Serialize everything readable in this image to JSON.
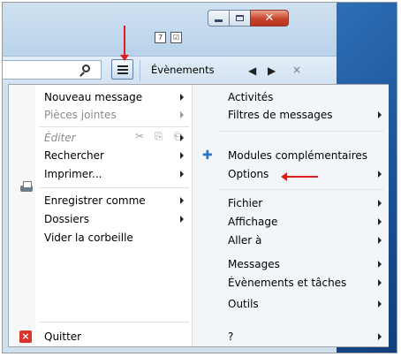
{
  "window": {
    "minimize_icon": "minimize-icon",
    "maximize_icon": "maximize-icon",
    "close_glyph": "✕",
    "calendar_glyph": "7",
    "tasks_glyph": "☑"
  },
  "toolbar": {
    "menu_button_icon": "hamburger-menu-icon",
    "events_tab_label": "Évènements",
    "prev_glyph": "◀",
    "next_glyph": "▶",
    "close_glyph": "×"
  },
  "menu": {
    "left": [
      {
        "label": "Nouveau message",
        "submenu": true,
        "disabled": false
      },
      {
        "label": "Pièces jointes",
        "submenu": true,
        "disabled": true
      },
      {
        "label": "Éditer",
        "submenu": true,
        "disabled": true
      },
      {
        "label": "Rechercher",
        "submenu": true,
        "disabled": false
      },
      {
        "label": "Imprimer...",
        "submenu": true,
        "disabled": false,
        "icon": "printer-icon"
      },
      {
        "label": "Enregistrer comme",
        "submenu": true,
        "disabled": false
      },
      {
        "label": "Dossiers",
        "submenu": true,
        "disabled": false
      },
      {
        "label": "Vider la corbeille",
        "submenu": false,
        "disabled": false
      },
      {
        "label": "Quitter",
        "submenu": false,
        "disabled": false,
        "icon": "quit-icon"
      }
    ],
    "edit_tools": "✂ ⎘ ⎗",
    "right": [
      {
        "label": "Activités",
        "submenu": false
      },
      {
        "label": "Filtres de messages",
        "submenu": true
      },
      {
        "label": "Modules complémentaires",
        "submenu": false,
        "icon": "puzzle-piece-icon"
      },
      {
        "label": "Options",
        "submenu": true
      },
      {
        "label": "Fichier",
        "submenu": true
      },
      {
        "label": "Affichage",
        "submenu": true
      },
      {
        "label": "Aller à",
        "submenu": true
      },
      {
        "label": "Messages",
        "submenu": true
      },
      {
        "label": "Évènements et tâches",
        "submenu": true
      },
      {
        "label": "Outils",
        "submenu": true
      },
      {
        "label": "?",
        "submenu": true
      }
    ]
  },
  "annotations": {
    "color": "#e21b1b"
  }
}
